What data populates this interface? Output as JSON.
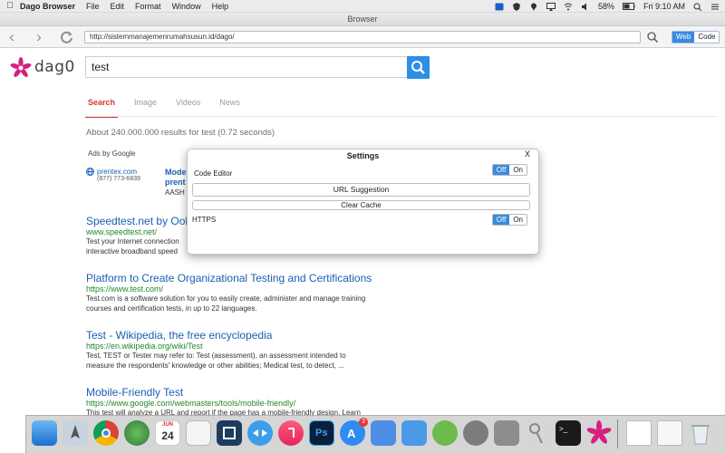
{
  "menubar": {
    "app_name": "Dago Browser",
    "menus": [
      "File",
      "Edit",
      "Format",
      "Window",
      "Help"
    ],
    "battery": "58%",
    "clock": "Fri 9:10 AM"
  },
  "window": {
    "title": "Browser"
  },
  "toolbar": {
    "url": "http://sistemmanajemenrumahsusun.id/dago/",
    "mode_web": "Web",
    "mode_code": "Code"
  },
  "logo": {
    "text": "dag0"
  },
  "search": {
    "query": "test"
  },
  "tabs": [
    {
      "label": "Search",
      "active": true
    },
    {
      "label": "Image",
      "active": false
    },
    {
      "label": "Videos",
      "active": false
    },
    {
      "label": "News",
      "active": false
    }
  ],
  "stats": "About 240.000.000 results for test (0.72 seconds)",
  "ads": {
    "label": "Ads by Google",
    "domain": "prentex.com",
    "phone": "(877) 773-6839",
    "title_line1": "Mode",
    "title_line2": "prent",
    "desc": "AASH"
  },
  "results": [
    {
      "title": "Speedtest.net by Ookla",
      "url": "www.speedtest.net/",
      "desc": [
        "Test your Internet connection",
        "interactive broadband speed"
      ]
    },
    {
      "title": "Platform to Create Organizational Testing and Certifications",
      "url": "https://www.test.com/",
      "desc": [
        "Test.com is a software solution for you to easily create, administer and manage training",
        "courses and certification tests, in up to 22 languages."
      ]
    },
    {
      "title": "Test - Wikipedia, the free encyclopedia",
      "url": "https://en.wikipedia.org/wiki/Test",
      "desc": [
        "Test, TEST or Tester may refer to: Test (assessment), an assessment intended to",
        "measure the respondents' knowledge or other abilities; Medical test, to detect, ..."
      ]
    },
    {
      "title": "Mobile-Friendly Test",
      "url": "https://www.google.com/webmasters/tools/mobile-friendly/",
      "desc": [
        "This test will analyze a URL and report if the page has a mobile-friendly design. Learn"
      ]
    }
  ],
  "settings": {
    "title": "Settings",
    "close": "X",
    "code_editor_label": "Code Editor",
    "url_suggestion": "URL Suggestion",
    "clear_cache": "Clear Cache",
    "https_label": "HTTPS",
    "off": "Off",
    "on": "On"
  },
  "dock": {
    "calendar_day": "24",
    "calendar_month": "JUN",
    "badge": "3"
  },
  "colors": {
    "accent": "#2d8ee6",
    "link": "#1a5fb4",
    "url_green": "#1e8a2a",
    "active_tab": "#d43a2c",
    "logo_pink": "#d4217f"
  }
}
